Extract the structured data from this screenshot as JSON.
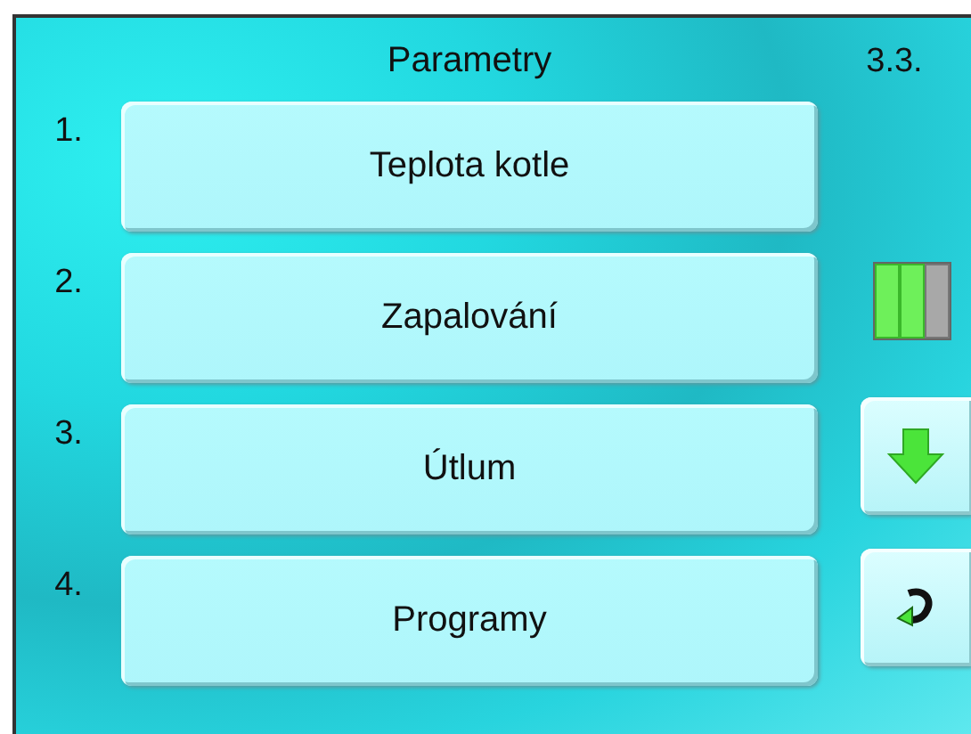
{
  "header": {
    "title": "Parametry",
    "screen_number": "3.3."
  },
  "menu_items": [
    {
      "number": "1.",
      "label": "Teplota kotle"
    },
    {
      "number": "2.",
      "label": "Zapalování"
    },
    {
      "number": "3.",
      "label": "Útlum"
    },
    {
      "number": "4.",
      "label": "Programy"
    }
  ],
  "page_indicator": {
    "segments": [
      {
        "on": true
      },
      {
        "on": true
      },
      {
        "on": false
      }
    ]
  },
  "side_buttons": [
    {
      "kind": "down"
    },
    {
      "kind": "return"
    }
  ]
}
